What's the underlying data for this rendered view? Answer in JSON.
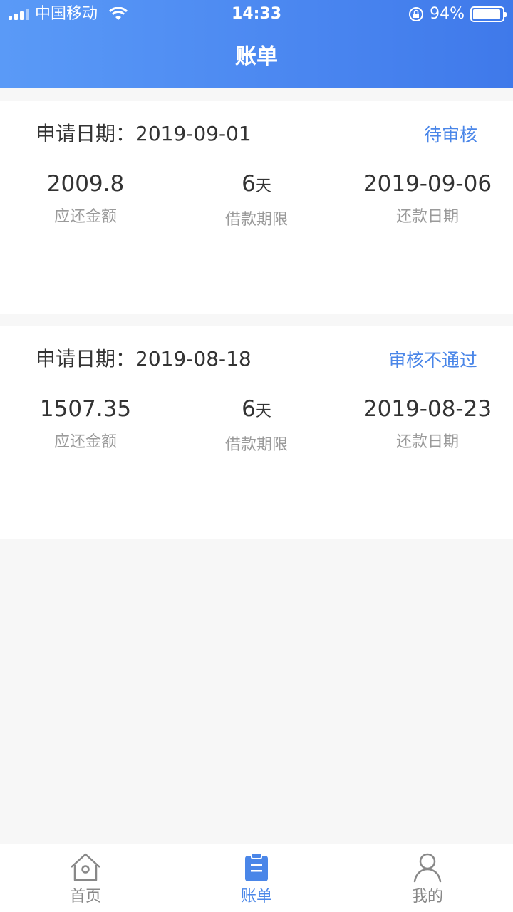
{
  "status_bar": {
    "carrier": "中国移动",
    "time": "14:33",
    "battery": "94%",
    "battery_level": 0.94
  },
  "header": {
    "title": "账单"
  },
  "bills": [
    {
      "date_label": "申请日期：",
      "date": "2019-09-01",
      "status": "待审核",
      "amount": "2009.8",
      "amount_label": "应还金额",
      "term": "6",
      "term_unit": "天",
      "term_label": "借款期限",
      "due_date": "2019-09-06",
      "due_label": "还款日期"
    },
    {
      "date_label": "申请日期：",
      "date": "2019-08-18",
      "status": "审核不通过",
      "amount": "1507.35",
      "amount_label": "应还金额",
      "term": "6",
      "term_unit": "天",
      "term_label": "借款期限",
      "due_date": "2019-08-23",
      "due_label": "还款日期"
    }
  ],
  "tabbar": {
    "active_color": "#4a86e8",
    "inactive_color": "#888888",
    "items": [
      {
        "label": "首页",
        "icon": "home-icon"
      },
      {
        "label": "账单",
        "icon": "bill-icon"
      },
      {
        "label": "我的",
        "icon": "user-icon"
      }
    ]
  }
}
